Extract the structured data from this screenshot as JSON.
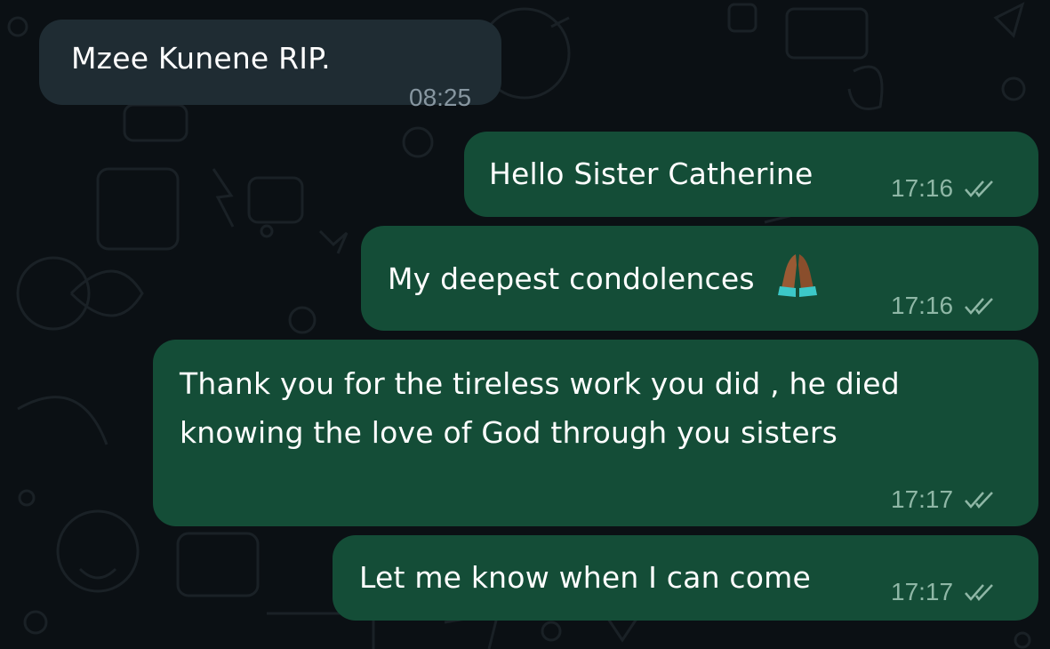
{
  "messages": [
    {
      "direction": "incoming",
      "text": "Mzee Kunene RIP.",
      "time": "08:25"
    },
    {
      "direction": "outgoing",
      "text": "Hello Sister Catherine",
      "time": "17:16",
      "status": "read"
    },
    {
      "direction": "outgoing",
      "text": "My deepest condolences",
      "emoji": "folded-hands-icon",
      "time": "17:16",
      "status": "read"
    },
    {
      "direction": "outgoing",
      "text": "Thank you for the tireless work you did , he died knowing the love of God through you sisters",
      "time": "17:17",
      "status": "read"
    },
    {
      "direction": "outgoing",
      "text": "Let me know when I can come",
      "time": "17:17",
      "status": "read"
    }
  ],
  "colors": {
    "background": "#0b1014",
    "incoming_bubble": "#1f2c33",
    "outgoing_bubble": "#144d37",
    "incoming_meta": "#8796a0",
    "outgoing_meta": "#8fb7a6",
    "read_ticks": "#8fb7a6"
  }
}
